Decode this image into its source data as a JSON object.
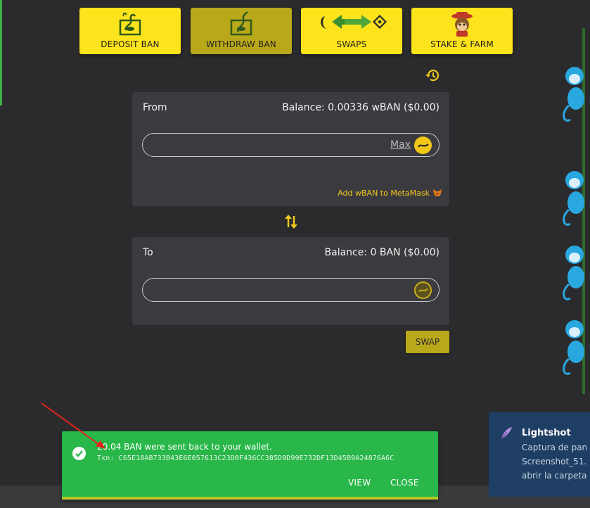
{
  "nav": {
    "deposit_label": "DEPOSIT BAN",
    "withdraw_label": "WITHDRAW BAN",
    "swaps_label": "SWAPS",
    "stake_label": "STAKE & FARM"
  },
  "from": {
    "label": "From",
    "balance": "Balance: 0.00336 wBAN ($0.00)",
    "max_label": "Max",
    "add_metamask": "Add wBAN to MetaMask"
  },
  "to": {
    "label": "To",
    "balance": "Balance: 0 BAN ($0.00)"
  },
  "swap_label": "SWAP",
  "toast": {
    "message": "20.04 BAN were sent back to your wallet.",
    "txn": "Txn: C65E18AB733B43E6E057613C23D0F436CC385D9D99E732DF13D45B9A24876A6C",
    "view_label": "VIEW",
    "close_label": "CLOSE"
  },
  "lightshot": {
    "title": "Lightshot",
    "line1": "Captura de pan",
    "line2": "Screenshot_51.",
    "line3": "abrir la carpeta"
  },
  "colors": {
    "background": "#2b2b2d",
    "accent_yellow": "#fde31b",
    "card": "#3b3b3f",
    "toast_green": "#28b748",
    "lightshot_blue": "#1e3e63"
  },
  "icons": [
    "history-icon",
    "max-coin-icon",
    "metamask-fox-icon",
    "swap-direction-icon",
    "ban-coin-icon",
    "check-icon",
    "lightshot-feather-icon"
  ]
}
